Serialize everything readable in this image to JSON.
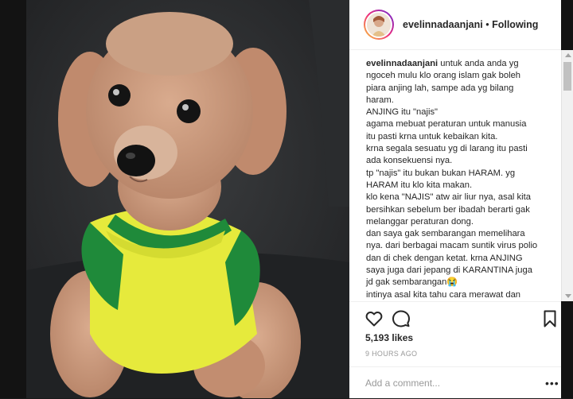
{
  "post": {
    "username": "evelinnadaanjani",
    "separator": "•",
    "follow_label": "Following",
    "caption_lines": [
      "untuk anda anda yg",
      "ngoceh mulu klo orang islam gak boleh",
      "piara anjing lah, sampe ada yg bilang",
      "haram.",
      "ANJING itu \"najis\"",
      "agama mebuat peraturan untuk manusia",
      "itu pasti krna untuk kebaikan kita.",
      "krna segala sesuatu yg di larang itu pasti",
      "ada konsekuensi nya.",
      "tp \"najis\" itu bukan bukan HARAM. yg",
      "HARAM itu klo kita makan.",
      "klo kena \"NAJIS\" atw air liur nya, asal kita",
      "bersihkan sebelum ber ibadah berarti gak",
      "melanggar peraturan dong.",
      "dan saya gak sembarangan memelihara",
      "nya. dari berbagai macam suntik virus polio",
      "dan di chek dengan ketat. krna ANJING",
      "saya juga dari jepang di KARANTINA juga",
      "jd gak sembarangan😭",
      "intinya asal kita tahu cara merawat dan"
    ],
    "likes": "5,193 likes",
    "time_ago": "9 HOURS AGO",
    "comment_placeholder": "Add a comment...",
    "more_label": "•••"
  },
  "colors": {
    "text": "#262626",
    "muted": "#999999",
    "border": "#efefef",
    "shirt_yellow": "#e6ea3c",
    "shirt_green": "#1f8a3a",
    "dog_fur": "#c8977a"
  }
}
